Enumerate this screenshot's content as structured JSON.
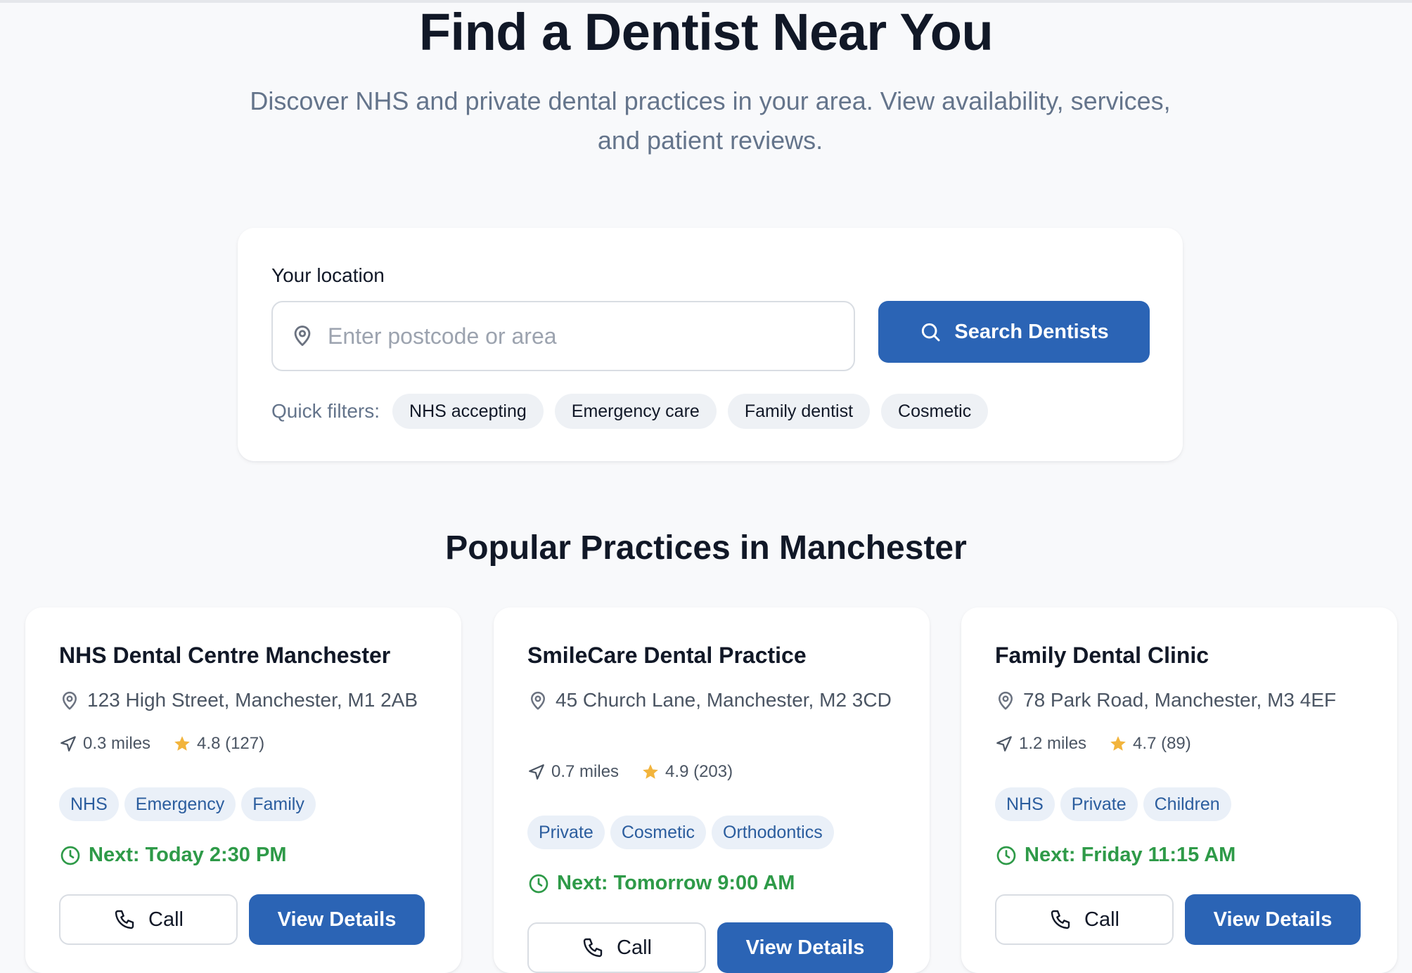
{
  "hero": {
    "title": "Find a Dentist Near You",
    "subtitle": "Discover NHS and private dental practices in your area. View availability, services, and patient reviews."
  },
  "search": {
    "label": "Your location",
    "placeholder": "Enter postcode or area",
    "value": "",
    "button_label": "Search Dentists",
    "quick_filters_label": "Quick filters:",
    "quick_filters": [
      "NHS accepting",
      "Emergency care",
      "Family dentist",
      "Cosmetic"
    ]
  },
  "section": {
    "title": "Popular Practices in Manchester"
  },
  "practices": [
    {
      "name": "NHS Dental Centre Manchester",
      "address": "123 High Street, Manchester, M1 2AB",
      "distance": "0.3 miles",
      "rating": "4.8 (127)",
      "tags": [
        "NHS",
        "Emergency",
        "Family"
      ],
      "next": "Next: Today 2:30 PM",
      "call_label": "Call",
      "details_label": "View Details"
    },
    {
      "name": "SmileCare Dental Practice",
      "address": "45 Church Lane, Manchester, M2 3CD",
      "distance": "0.7 miles",
      "rating": "4.9 (203)",
      "tags": [
        "Private",
        "Cosmetic",
        "Orthodontics"
      ],
      "next": "Next: Tomorrow 9:00 AM",
      "call_label": "Call",
      "details_label": "View Details"
    },
    {
      "name": "Family Dental Clinic",
      "address": "78 Park Road, Manchester, M3 4EF",
      "distance": "1.2 miles",
      "rating": "4.7 (89)",
      "tags": [
        "NHS",
        "Private",
        "Children"
      ],
      "next": "Next: Friday 11:15 AM",
      "call_label": "Call",
      "details_label": "View Details"
    }
  ],
  "colors": {
    "primary": "#2b64b5",
    "available": "#2e9a48",
    "star": "#f2b43c",
    "tag_text": "#2b5d9e",
    "tag_bg": "#eaf0f8"
  },
  "icons": {
    "location": "map-pin-icon",
    "search": "search-icon",
    "distance": "navigation-arrow-icon",
    "rating": "star-icon",
    "availability": "clock-icon",
    "call": "phone-icon"
  }
}
